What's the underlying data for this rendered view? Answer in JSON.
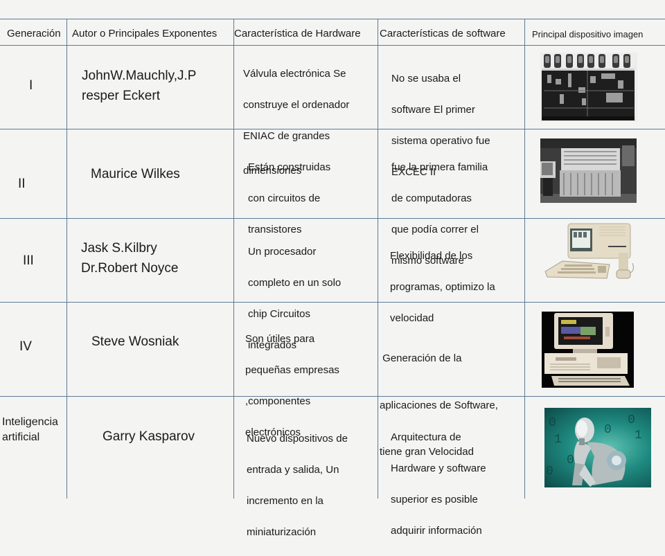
{
  "table": {
    "headers": [
      "Generación",
      "Autor o Principales Exponentes",
      "Característica de Hardware",
      "Características de software",
      "Principal dispositivo imagen"
    ],
    "rows": [
      {
        "generation": "I",
        "author": "JohnW.Mauchly,J.P\nresper Eckert",
        "author_lines": [
          "JohnW.Mauchly,J.P",
          "resper Eckert"
        ],
        "hardware_lines": [
          "Válvula electrónica Se",
          "construye el ordenador",
          "ENIAC de grandes",
          "dimensiones"
        ],
        "software_lines": [
          "No se usaba el",
          "software El primer",
          "sistema operativo fue",
          "EXCEC II"
        ],
        "image": "eniac-vacuum-tube-computer"
      },
      {
        "generation": "II",
        "author_lines": [
          "Maurice Wilkes"
        ],
        "hardware_lines": [
          "Están construidas",
          "con circuitos de",
          "transistores"
        ],
        "software_lines": [
          "fue la primera familia",
          "de computadoras",
          "que podía correr el",
          "mismo software"
        ],
        "image": "transistor-mainframe-computer"
      },
      {
        "generation": "III",
        "author_lines": [
          "Jask S.Kilbry",
          "Dr.Robert Noyce"
        ],
        "hardware_lines": [
          "Un procesador",
          "completo en un solo",
          "chip  Circuitos",
          "integrados"
        ],
        "software_lines": [
          "Flexibilidad de los",
          "programas, optimizo la",
          "velocidad"
        ],
        "image": "desktop-computer-lisa"
      },
      {
        "generation": "IV",
        "author_lines": [
          "Steve Wosniak"
        ],
        "hardware_lines": [
          "Son útiles para",
          "pequeñas empresas",
          ",componentes",
          "electrónicos"
        ],
        "software_lines": [
          " Generación de la",
          "aplicaciones de Software,",
          "tiene gran Velocidad"
        ],
        "image": "ibm-pc-computer"
      },
      {
        "generation": "Inteligencia\nartificial",
        "generation_lines": [
          "Inteligencia",
          "artificial"
        ],
        "author_lines": [
          "Garry Kasparov"
        ],
        "hardware_lines": [
          "Nuevo dispositivos de",
          "entrada y salida, Un",
          "incremento en la",
          "miniaturización"
        ],
        "software_lines": [
          "Arquitectura de",
          "Hardware y software",
          "superior es posible",
          "adquirir información"
        ],
        "image": "thinking-robot-ai"
      }
    ]
  },
  "colors": {
    "background": "#f4f4f3",
    "grid_line": "#5b7a94",
    "text": "#1a1a1a",
    "ai_image_teal": "#1f8a80"
  }
}
